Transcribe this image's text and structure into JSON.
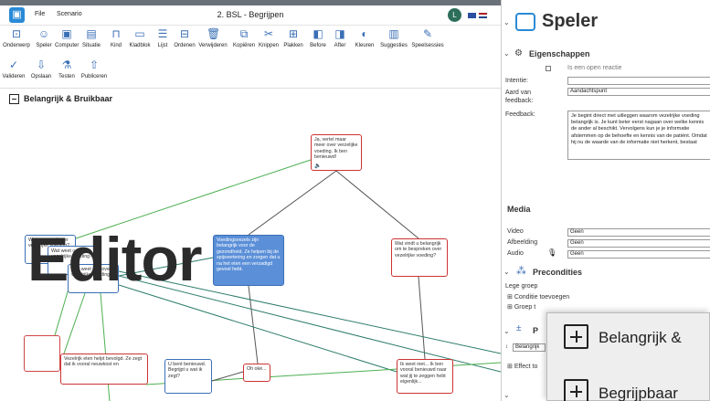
{
  "window": {
    "title": "2. BSL - Begrijpen",
    "menu": [
      "File",
      "Scenario"
    ],
    "user_initial": "L"
  },
  "toolbar": {
    "row1": [
      "Onderwerp",
      "Speler",
      "Computer",
      "Situatie",
      "Kind",
      "Kladblok",
      "Lijst",
      "Ordenen",
      "Verwijderen",
      "Kopiëren",
      "Knippen",
      "Plakken",
      "Before",
      "After",
      "Kleuren",
      "Suggesties",
      "Speelsessies"
    ],
    "row2": [
      "Valideren",
      "Opslaan",
      "Testen",
      "Publiceren"
    ]
  },
  "canvas": {
    "section_title": "Belangrijk & Bruikbaar",
    "overlay_text": "Editor",
    "nodes": [
      {
        "id": "n1",
        "text": "Ja, vertel maar meer over verzelijke voeding. Ik ben benieuwd!"
      },
      {
        "id": "n2",
        "text": "Voedingsvezels zijn belangrijk voor de gezondheid. Ze helpen bij de spijsvertering en zorgen dat u na het eten een verzadigd gevoel hebt."
      },
      {
        "id": "n3",
        "text": "Wat vindt u belangrijk om te bespreken over vezelrijke voeding?"
      },
      {
        "id": "n4",
        "text": "Wat weet u al over vezelrijke voeding?"
      },
      {
        "id": "n5",
        "text": "Wat weet u al over vezelrijke voeding?"
      },
      {
        "id": "n6",
        "text": "Wat weet u al over vezelrijke voeding?"
      },
      {
        "id": "n7",
        "text": "Oh oké..."
      },
      {
        "id": "n8",
        "text": "Ik weet niet... Ik ben vooral benieuwd naar wat jij te zeggen hebt eigenlijk..."
      },
      {
        "id": "n9",
        "text": "U bent benieuwd. Begrijpt u wat ik zegt?"
      },
      {
        "id": "n10",
        "text": "Vezelrijk eten helpt bevolgd. Ze zegt dat ik vooral neuwkost en"
      }
    ]
  },
  "panel": {
    "title": "Speler",
    "eigenschappen": {
      "header": "Eigenschappen",
      "open_reactie": "Is een open reactie",
      "intentie_label": "Intentie:",
      "intentie_value": "",
      "aard_label": "Aard van feedback:",
      "aard_value": "Aandachtspunt",
      "feedback_label": "Feedback:",
      "feedback_text": "Je begint direct met uitleggen waarom vezelrijke voeding belangrijk is. Je kunt beter eerst nagaan over welke kennis de ander al beschikt. Vervolgens kun je je informatie afstemmen op de behoefte en kennis van de patiënt. Omdat hij nu de waarde van de informatie niet herkent, bestaat"
    },
    "media": {
      "header": "Media",
      "rows": [
        {
          "label": "Video",
          "value": "Geen"
        },
        {
          "label": "Afbeelding",
          "value": "Geen"
        },
        {
          "label": "Audio",
          "value": "Geen"
        }
      ]
    },
    "precondities": {
      "header": "Precondities",
      "lege_groep": "Lege groep",
      "conditie_toevoegen": "Conditie toevoegen",
      "groep_label": "Groep t",
      "p_header": "P",
      "belangrijk_select": "Belangrijk",
      "effect_label": "Effect to"
    }
  },
  "popup": {
    "items": [
      "Belangrijk &",
      "Begrijpbaar"
    ]
  }
}
